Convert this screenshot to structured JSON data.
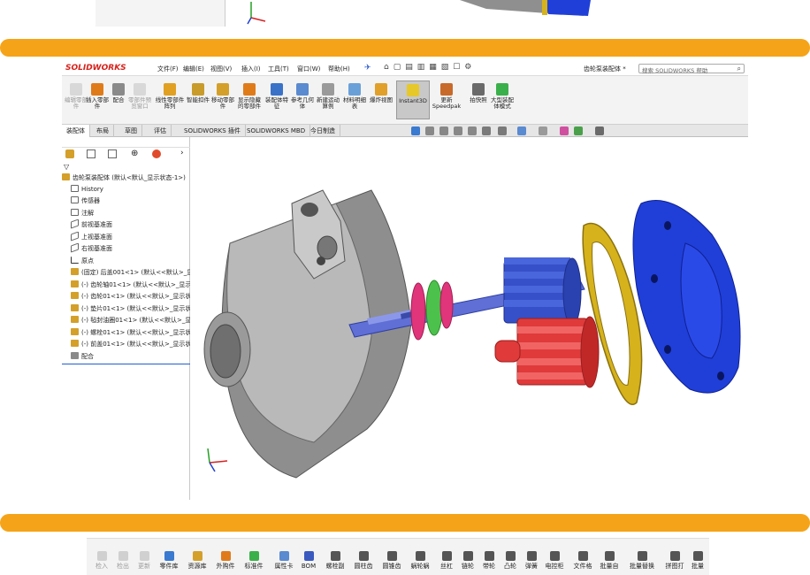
{
  "menubar": {
    "logo": "SOLIDWORKS",
    "menus": [
      "文件(F)",
      "编辑(E)",
      "视图(V)",
      "插入(I)",
      "工具(T)",
      "窗口(W)",
      "帮助(H)"
    ],
    "doc_title": "齿轮泵装配体 *",
    "search_placeholder": "搜索 SOLIDWORKS 帮助"
  },
  "toolbar": {
    "items": [
      {
        "label": "编辑零部件",
        "disabled": true
      },
      {
        "label": "插入零部件",
        "disabled": false
      },
      {
        "label": "配合",
        "disabled": false
      },
      {
        "label": "零部件预览窗口",
        "disabled": true
      },
      {
        "label": "线性零部件阵列",
        "disabled": false
      },
      {
        "label": "智能扣件",
        "disabled": false
      },
      {
        "label": "移动零部件",
        "disabled": false
      },
      {
        "label": "显示隐藏的零部件",
        "disabled": false
      },
      {
        "label": "装配体特征",
        "disabled": false
      },
      {
        "label": "参考几何体",
        "disabled": false
      },
      {
        "label": "新建运动算例",
        "disabled": false
      },
      {
        "label": "材料明细表",
        "disabled": false
      },
      {
        "label": "爆炸视图",
        "disabled": false
      },
      {
        "label": "Instant3D",
        "disabled": false
      },
      {
        "label": "更新Speedpak",
        "disabled": false
      },
      {
        "label": "拍快照",
        "disabled": false
      },
      {
        "label": "大型装配体模式",
        "disabled": false
      }
    ]
  },
  "tabs": [
    "装配体",
    "布局",
    "草图",
    "评估",
    "SOLIDWORKS 插件",
    "SOLIDWORKS MBD",
    "今日制造"
  ],
  "tree": {
    "root": "齿轮泵装配体 (默认<默认_显示状态-1>)",
    "items": [
      "History",
      "传感器",
      "注解",
      "前视基准面",
      "上视基准面",
      "右视基准面",
      "原点",
      "(固定) 后盖001<1> (默认<<默认>_显",
      "(-) 齿轮轴01<1> (默认<<默认>_显示",
      "(-) 齿轮01<1> (默认<<默认>_显示状",
      "(-) 垫片01<1> (默认<<默认>_显示状",
      "(-) 毡封油圈01<1> (默认<<默认>_显",
      "(-) 螺栓01<1> (默认<<默认>_显示状",
      "(-) 前盖01<1> (默认<<默认>_显示状",
      "配合"
    ]
  },
  "bottom_toolbar": {
    "items": [
      {
        "label": "检入",
        "disabled": true
      },
      {
        "label": "检出",
        "disabled": true
      },
      {
        "label": "更新",
        "disabled": true
      },
      {
        "label": "零件库",
        "disabled": false
      },
      {
        "label": "资源库",
        "disabled": false
      },
      {
        "label": "外购件",
        "disabled": false
      },
      {
        "label": "标准件",
        "disabled": false
      },
      {
        "label": "属性卡",
        "disabled": false
      },
      {
        "label": "BOM",
        "disabled": false
      },
      {
        "label": "螺栓副",
        "disabled": false
      },
      {
        "label": "圆柱齿",
        "disabled": false
      },
      {
        "label": "圆锥齿",
        "disabled": false
      },
      {
        "label": "蜗轮蜗",
        "disabled": false
      },
      {
        "label": "丝杠",
        "disabled": false
      },
      {
        "label": "链轮",
        "disabled": false
      },
      {
        "label": "带轮",
        "disabled": false
      },
      {
        "label": "凸轮",
        "disabled": false
      },
      {
        "label": "弹簧",
        "disabled": false
      },
      {
        "label": "电控柜",
        "disabled": false
      },
      {
        "label": "文件格",
        "disabled": false
      },
      {
        "label": "批量自",
        "disabled": false
      },
      {
        "label": "批量替换",
        "disabled": false
      },
      {
        "label": "拼图打",
        "disabled": false
      },
      {
        "label": "批量",
        "disabled": false
      }
    ]
  },
  "colors": {
    "accent_bar": "#f5a318",
    "housing": "#9a9a9a",
    "gear_blue": "#3550c8",
    "gear_red": "#e03a3a",
    "gasket": "#d6b21c",
    "cover": "#1f3fd8",
    "seal_pink": "#e0357a",
    "seal_green": "#4cc24c"
  }
}
